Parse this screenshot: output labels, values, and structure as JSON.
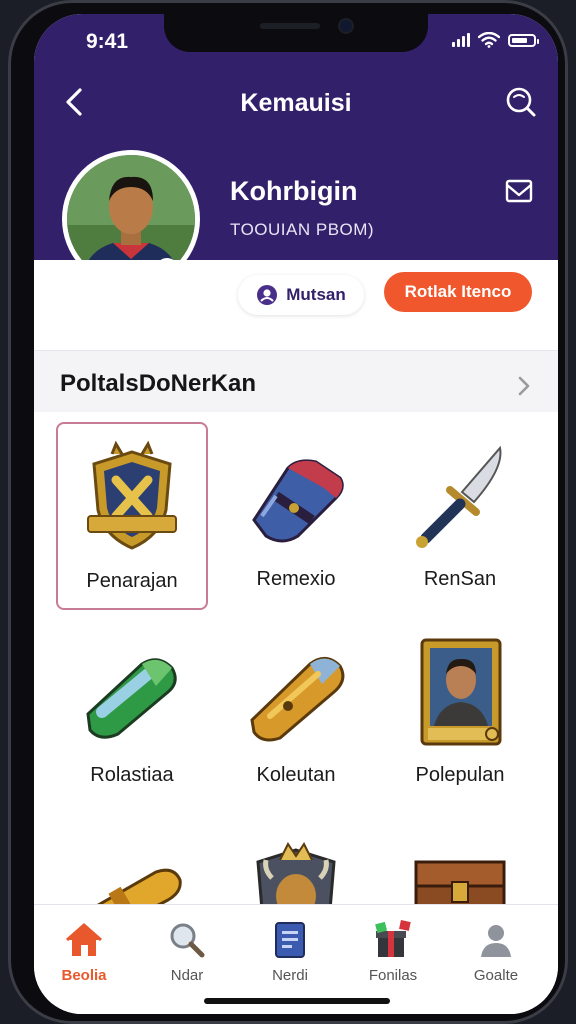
{
  "status_bar": {
    "time": "9:41"
  },
  "nav": {
    "title": "Kemauisi"
  },
  "profile": {
    "name": "Kohrbigin",
    "subtitle": "TOOUIAN PBOM)",
    "secondary_button": "Mutsan",
    "primary_button": "Rotlak Itenco"
  },
  "section": {
    "title": "PoltalsDoNerKan"
  },
  "items": [
    {
      "label": "Penarajan",
      "icon": "shield-emblem-icon",
      "selected": true
    },
    {
      "label": "Remexio",
      "icon": "gauntlet-icon",
      "selected": false
    },
    {
      "label": "RenSan",
      "icon": "dagger-icon",
      "selected": false
    },
    {
      "label": "Rolastiaa",
      "icon": "green-gauntlet-icon",
      "selected": false
    },
    {
      "label": "Koleutan",
      "icon": "gold-bracer-icon",
      "selected": false
    },
    {
      "label": "Polepulan",
      "icon": "portrait-card-icon",
      "selected": false
    },
    {
      "label": "",
      "icon": "gold-cannon-icon",
      "selected": false
    },
    {
      "label": "",
      "icon": "bull-crest-icon",
      "selected": false
    },
    {
      "label": "",
      "icon": "treasure-chest-icon",
      "selected": false
    }
  ],
  "tabs": [
    {
      "label": "Beolia",
      "icon": "home-icon",
      "active": true
    },
    {
      "label": "Ndar",
      "icon": "magnifier-icon",
      "active": false
    },
    {
      "label": "Nerdi",
      "icon": "book-icon",
      "active": false
    },
    {
      "label": "Fonilas",
      "icon": "gift-box-icon",
      "active": false
    },
    {
      "label": "Goalte",
      "icon": "person-icon",
      "active": false
    }
  ],
  "colors": {
    "header": "#33206b",
    "accent": "#f0572c",
    "active_tab": "#e9582d"
  }
}
